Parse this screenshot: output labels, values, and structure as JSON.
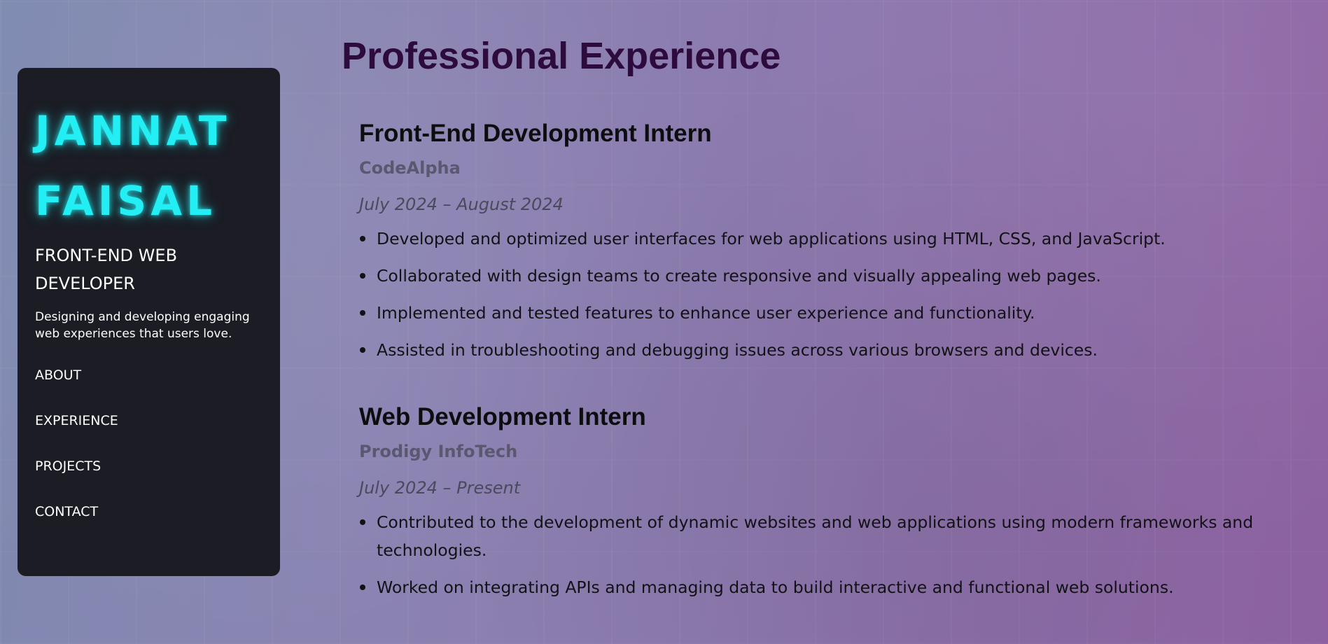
{
  "sidebar": {
    "name_line1": "JANNAT",
    "name_line2": "FAISAL",
    "role": "FRONT-END WEB DEVELOPER",
    "tagline": "Designing and developing engaging web experiences that users love.",
    "nav": [
      {
        "label": "ABOUT"
      },
      {
        "label": "EXPERIENCE"
      },
      {
        "label": "PROJECTS"
      },
      {
        "label": "CONTACT"
      }
    ]
  },
  "main": {
    "title": "Professional Experience",
    "jobs": [
      {
        "title": "Front-End Development Intern",
        "company": "CodeAlpha",
        "dates": "July 2024 – August 2024",
        "duties": [
          "Developed and optimized user interfaces for web applications using HTML, CSS, and JavaScript.",
          "Collaborated with design teams to create responsive and visually appealing web pages.",
          "Implemented and tested features to enhance user experience and functionality.",
          "Assisted in troubleshooting and debugging issues across various browsers and devices."
        ]
      },
      {
        "title": "Web Development Intern",
        "company": "Prodigy InfoTech",
        "dates": "July 2024 – Present",
        "duties": [
          "Contributed to the development of dynamic websites and web applications using modern frameworks and technologies.",
          "Worked on integrating APIs and managing data to build interactive and functional web solutions."
        ]
      }
    ]
  },
  "colors": {
    "name_glow": "#22eef4",
    "sidebar_bg": "#1b1c24",
    "page_title": "#2d0b3c",
    "company": "#5a5870"
  }
}
